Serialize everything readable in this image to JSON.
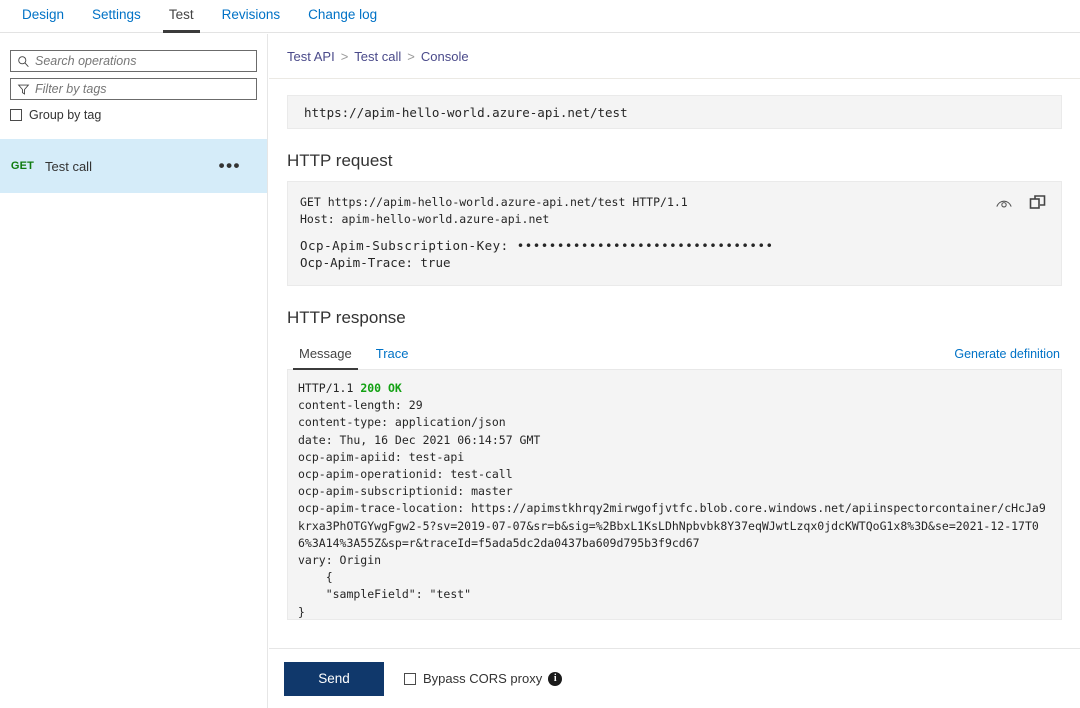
{
  "top_tabs": [
    {
      "label": "Design",
      "active": false
    },
    {
      "label": "Settings",
      "active": false
    },
    {
      "label": "Test",
      "active": true
    },
    {
      "label": "Revisions",
      "active": false
    },
    {
      "label": "Change log",
      "active": false
    }
  ],
  "sidebar": {
    "search_placeholder": "Search operations",
    "filter_placeholder": "Filter by tags",
    "group_by_tag_label": "Group by tag",
    "operation": {
      "method": "GET",
      "name": "Test call",
      "more_label": "•••"
    }
  },
  "breadcrumb": {
    "item1": "Test API",
    "sep1": ">",
    "item2": "Test call",
    "sep2": ">",
    "item3": "Console"
  },
  "url_bar": "https://apim-hello-world.azure-api.net/test",
  "http_request": {
    "heading": "HTTP request",
    "line_request": "GET https://apim-hello-world.azure-api.net/test HTTP/1.1",
    "line_host": "Host: apim-hello-world.azure-api.net",
    "line_subscription_key": "Ocp-Apim-Subscription-Key: ••••••••••••••••••••••••••••••••",
    "line_trace": "Ocp-Apim-Trace: true"
  },
  "http_response": {
    "heading": "HTTP response",
    "tabs": [
      {
        "label": "Message",
        "active": true
      },
      {
        "label": "Trace",
        "active": false
      }
    ],
    "generate_definition_label": "Generate definition",
    "status_line_prefix": "HTTP/1.1 ",
    "status_code": "200 OK",
    "body": "content-length: 29\ncontent-type: application/json\ndate: Thu, 16 Dec 2021 06:14:57 GMT\nocp-apim-apiid: test-api\nocp-apim-operationid: test-call\nocp-apim-subscriptionid: master\nocp-apim-trace-location: https://apimstkhrqy2mirwgofjvtfc.blob.core.windows.net/apiinspectorcontainer/cHcJa9krxa3PhOTGYwgFgw2-5?sv=2019-07-07&sr=b&sig=%2BbxL1KsLDhNpbvbk8Y37eqWJwtLzqx0jdcKWTQoG1x8%3D&se=2021-12-17T06%3A14%3A55Z&sp=r&traceId=f5ada5dc2da0437ba609d795b3f9cd67\nvary: Origin\n    {\n    \"sampleField\": \"test\"\n}"
  },
  "footer": {
    "send_label": "Send",
    "bypass_cors_label": "Bypass CORS proxy",
    "info_glyph": "i"
  }
}
